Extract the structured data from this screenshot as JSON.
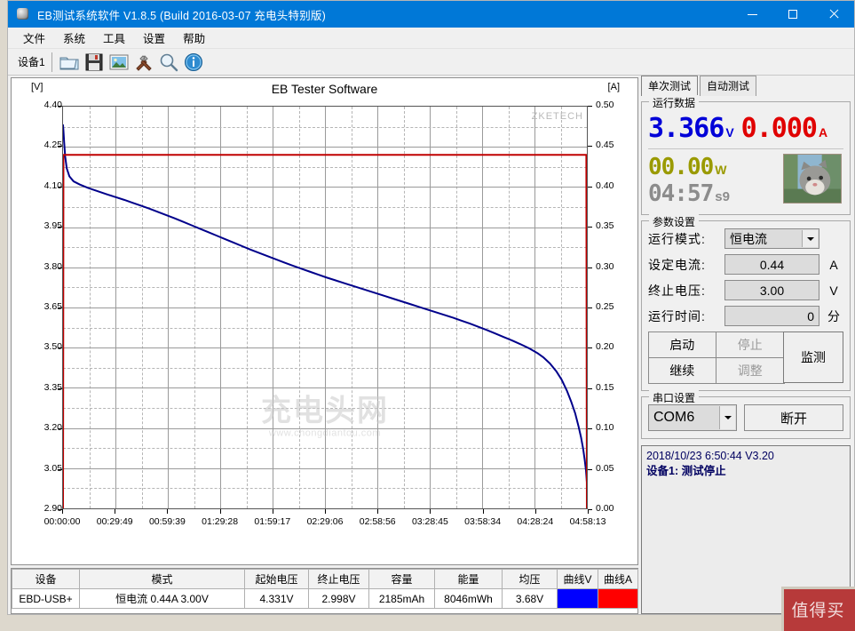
{
  "window": {
    "title": "EB测试系统软件 V1.8.5 (Build 2016-03-07 充电头特别版)",
    "app_icon": "cube-icon",
    "minimize": "−",
    "maximize": "□",
    "close": "×"
  },
  "menu": [
    {
      "label": "文件"
    },
    {
      "label": "系统"
    },
    {
      "label": "工具"
    },
    {
      "label": "设置"
    },
    {
      "label": "帮助"
    }
  ],
  "toolbar": {
    "device_tab": "设备1",
    "icons": [
      {
        "name": "open-folder-icon"
      },
      {
        "name": "save-floppy-icon"
      },
      {
        "name": "picture-icon"
      },
      {
        "name": "tools-icon"
      },
      {
        "name": "magnifier-icon"
      },
      {
        "name": "info-icon"
      }
    ]
  },
  "chart_data": {
    "type": "line",
    "title": "EB Tester Software",
    "xlabel": "",
    "ylabel": "[V]",
    "y2label": "[A]",
    "grid": true,
    "legend": "none",
    "watermark_plot": "ZKETECH",
    "watermark_center_cn": "充电头网",
    "watermark_center_url": "www.chongdiantou.com",
    "ylim": [
      2.9,
      4.4
    ],
    "y2lim": [
      0.0,
      0.5
    ],
    "yticks": [
      "4.40",
      "4.25",
      "4.10",
      "3.95",
      "3.80",
      "3.65",
      "3.50",
      "3.35",
      "3.20",
      "3.05",
      "2.90"
    ],
    "y2ticks": [
      "0.50",
      "0.45",
      "0.40",
      "0.35",
      "0.30",
      "0.25",
      "0.20",
      "0.15",
      "0.10",
      "0.05",
      "0.00"
    ],
    "xticks": [
      "00:00:00",
      "00:29:49",
      "00:59:39",
      "01:29:28",
      "01:59:17",
      "02:29:06",
      "02:58:56",
      "03:28:45",
      "03:58:34",
      "04:28:24",
      "04:58:13"
    ],
    "series": [
      {
        "name": "曲线V",
        "color": "#00008b",
        "axis": "left",
        "unit": "V",
        "x": [
          0.0,
          0.004,
          0.01,
          0.02,
          0.035,
          0.06,
          0.1,
          0.16,
          0.24,
          0.33,
          0.42,
          0.5,
          0.58,
          0.66,
          0.74,
          0.82,
          0.9,
          0.98,
          1.06,
          1.14,
          1.22,
          1.3,
          1.38,
          1.46,
          1.54,
          1.62,
          1.7,
          1.78,
          1.86,
          1.94,
          2.02,
          2.1,
          2.18,
          2.26,
          2.34,
          2.42,
          2.5,
          2.58,
          2.66,
          2.74,
          2.82,
          2.9,
          2.98,
          3.06,
          3.14,
          3.22,
          3.3,
          3.38,
          3.46,
          3.54,
          3.62,
          3.7,
          3.78,
          3.86,
          3.94,
          4.02,
          4.1,
          4.18,
          4.26,
          4.34,
          4.42,
          4.5,
          4.56,
          4.62,
          4.68,
          4.73,
          4.78,
          4.82,
          4.86,
          4.89,
          4.915,
          4.935,
          4.95,
          4.962,
          4.97
        ],
        "y": [
          4.331,
          4.31,
          4.27,
          4.215,
          4.17,
          4.14,
          4.121,
          4.109,
          4.096,
          4.084,
          4.072,
          4.062,
          4.052,
          4.041,
          4.03,
          4.019,
          4.007,
          3.995,
          3.983,
          3.97,
          3.957,
          3.944,
          3.931,
          3.918,
          3.905,
          3.892,
          3.879,
          3.866,
          3.854,
          3.842,
          3.83,
          3.818,
          3.806,
          3.795,
          3.784,
          3.773,
          3.762,
          3.752,
          3.742,
          3.732,
          3.722,
          3.712,
          3.702,
          3.692,
          3.682,
          3.672,
          3.662,
          3.652,
          3.642,
          3.632,
          3.622,
          3.612,
          3.601,
          3.59,
          3.578,
          3.566,
          3.553,
          3.54,
          3.527,
          3.513,
          3.498,
          3.48,
          3.463,
          3.441,
          3.412,
          3.381,
          3.34,
          3.3,
          3.254,
          3.208,
          3.165,
          3.122,
          3.08,
          3.04,
          2.998
        ]
      },
      {
        "name": "曲线A",
        "color": "#c00000",
        "axis": "right",
        "unit": "A",
        "x": [
          0.0,
          0.002,
          0.004,
          4.965,
          4.97
        ],
        "y": [
          0.0,
          0.2,
          0.44,
          0.44,
          0.0
        ]
      }
    ],
    "annotations": {
      "start_voltage": "4.331V",
      "end_voltage": "2.998V",
      "set_current": "0.44A"
    }
  },
  "table": {
    "headers": [
      "设备",
      "模式",
      "起始电压",
      "终止电压",
      "容量",
      "能量",
      "均压",
      "曲线V",
      "曲线A"
    ],
    "rows": [
      {
        "device": "EBD-USB+",
        "mode": "恒电流  0.44A  3.00V",
        "start_voltage": "4.331V",
        "end_voltage": "2.998V",
        "capacity": "2185mAh",
        "energy": "8046mWh",
        "avg_voltage": "3.68V",
        "curve_v_color": "#0000ff",
        "curve_a_color": "#ff0000"
      }
    ]
  },
  "right_panel": {
    "tabs": [
      {
        "label": "单次测试",
        "active": true
      },
      {
        "label": "自动测试",
        "active": false
      }
    ],
    "running_data": {
      "title": "运行数据",
      "voltage": "3.366",
      "voltage_unit": "V",
      "current": "0.000",
      "current_unit": "A",
      "power": "00.00",
      "power_unit": "W",
      "time": "04:57",
      "time_unit": "s9",
      "photo": "cat-photo"
    },
    "params": {
      "title": "参数设置",
      "rows": [
        {
          "label": "运行模式:",
          "value": "恒电流",
          "unit": "",
          "type": "combo"
        },
        {
          "label": "设定电流:",
          "value": "0.44",
          "unit": "A",
          "type": "text"
        },
        {
          "label": "终止电压:",
          "value": "3.00",
          "unit": "V",
          "type": "text"
        },
        {
          "label": "运行时间:",
          "value": "0",
          "unit": "分",
          "type": "text"
        }
      ]
    },
    "buttons": {
      "start": "启动",
      "stop": "停止",
      "continue": "继续",
      "adjust": "调整",
      "monitor": "监测"
    },
    "serial": {
      "title": "串口设置",
      "port": "COM6",
      "disconnect": "断开"
    },
    "log": {
      "line1": "2018/10/23 6:50:44  V3.20",
      "line2": "设备1: 测试停止"
    }
  },
  "badge": {
    "text": "值得买"
  }
}
